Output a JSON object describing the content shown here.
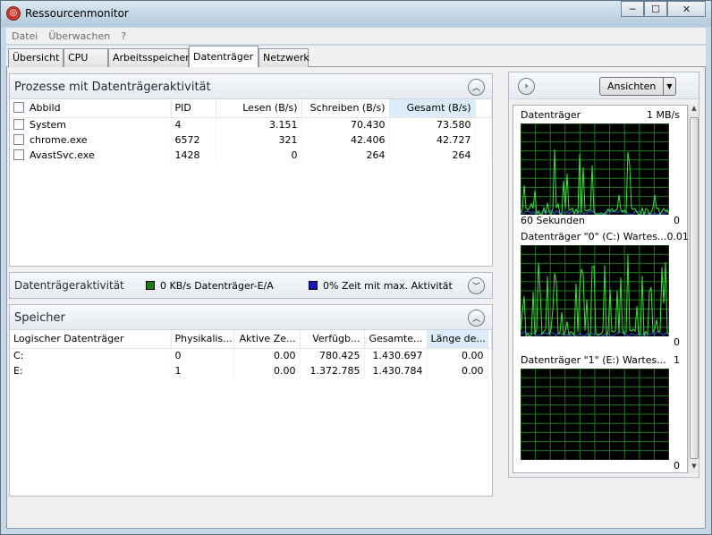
{
  "window": {
    "title": "Ressourcenmonitor",
    "minimize": "─",
    "maximize": "☐",
    "close": "✕"
  },
  "menu": {
    "items": [
      "Datei",
      "Überwachen",
      "?"
    ]
  },
  "tabs": [
    "Übersicht",
    "CPU",
    "Arbeitsspeicher",
    "Datenträger",
    "Netzwerk"
  ],
  "active_tab": "Datenträger",
  "processes": {
    "title": "Prozesse mit Datenträgeraktivität",
    "columns": [
      "Abbild",
      "PID",
      "Lesen (B/s)",
      "Schreiben (B/s)",
      "Gesamt (B/s)"
    ],
    "rows": [
      {
        "name": "System",
        "pid": "4",
        "read": "3.151",
        "write": "70.430",
        "total": "73.580"
      },
      {
        "name": "chrome.exe",
        "pid": "6572",
        "read": "321",
        "write": "42.406",
        "total": "42.727"
      },
      {
        "name": "AvastSvc.exe",
        "pid": "1428",
        "read": "0",
        "write": "264",
        "total": "264"
      }
    ]
  },
  "activity": {
    "title": "Datenträgeraktivität",
    "io_label": "0 KB/s Datenträger-E/A",
    "io_color": "#1a7a1a",
    "time_label": "0% Zeit mit max. Aktivität",
    "time_color": "#1616c8"
  },
  "storage": {
    "title": "Speicher",
    "columns": [
      "Logischer Datenträger",
      "Physikalis...",
      "Aktive Ze...",
      "Verfügb...",
      "Gesamte...",
      "Länge de..."
    ],
    "rows": [
      {
        "drive": "C:",
        "phys": "0",
        "active": "0.00",
        "avail": "780.425",
        "total": "1.430.697",
        "queue": "0.00"
      },
      {
        "drive": "E:",
        "phys": "1",
        "active": "0.00",
        "avail": "1.372.785",
        "total": "1.430.784",
        "queue": "0.00"
      }
    ]
  },
  "views": {
    "label": "Ansichten"
  },
  "graphs": [
    {
      "title": "Datenträger",
      "scale": "1 MB/s",
      "bottom_left": "60 Sekunden",
      "bottom_right": "0"
    },
    {
      "title": "Datenträger \"0\" (C:) Wartes...",
      "scale": "0.01",
      "bottom_left": "",
      "bottom_right": "0"
    },
    {
      "title": "Datenträger \"1\" (E:) Wartes...",
      "scale": "1",
      "bottom_left": "",
      "bottom_right": "0"
    }
  ],
  "colors": {
    "graph_bg": "#000000",
    "graph_grid": "#1e7a1e",
    "graph_line": "#33e533",
    "graph_line2": "#2a54d8"
  }
}
